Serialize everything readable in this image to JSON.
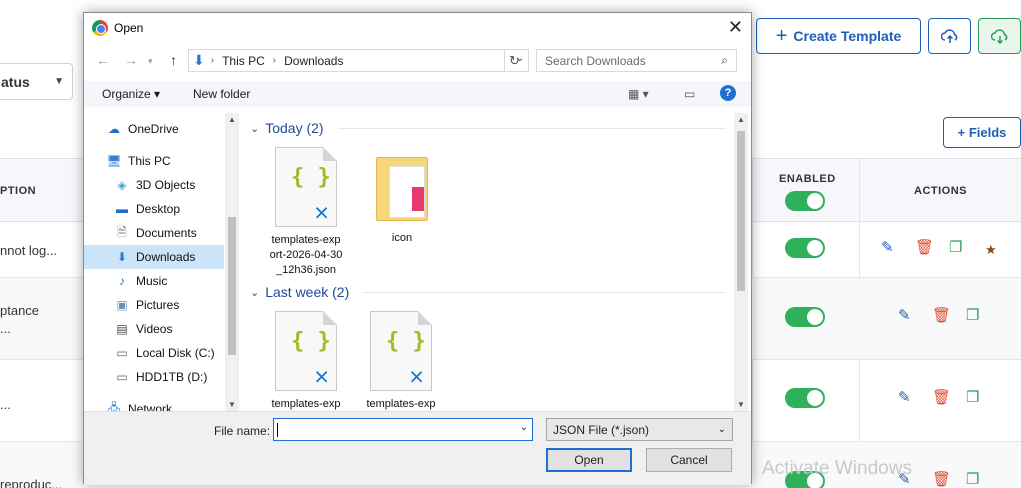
{
  "background": {
    "status_filter": "atus",
    "create_button": "Create Template",
    "fields_button": "+ Fields",
    "table_headers": {
      "description": "PTION",
      "enabled": "ENABLED",
      "actions": "ACTIONS"
    },
    "rows": [
      {
        "desc": "nnot log..."
      },
      {
        "desc": "ptance\n..."
      },
      {
        "desc": "..."
      },
      {
        "desc": "reproduc..."
      }
    ],
    "watermark": "Activate Windows",
    "colors": {
      "accent": "#1e5fb4",
      "toggle_on": "#2fb05b",
      "delete": "#e04a2f"
    }
  },
  "dialog": {
    "title": "Open",
    "path": [
      "This PC",
      "Downloads"
    ],
    "search_placeholder": "Search Downloads",
    "toolbar": {
      "organize": "Organize ▾",
      "new_folder": "New folder"
    },
    "nav_items": [
      {
        "label": "OneDrive",
        "icon": "cloud-icon"
      },
      {
        "label": "This PC",
        "icon": "computer-icon"
      },
      {
        "label": "3D Objects",
        "icon": "cube-icon"
      },
      {
        "label": "Desktop",
        "icon": "desktop-icon"
      },
      {
        "label": "Documents",
        "icon": "document-icon"
      },
      {
        "label": "Downloads",
        "icon": "download-icon",
        "selected": true
      },
      {
        "label": "Music",
        "icon": "music-icon"
      },
      {
        "label": "Pictures",
        "icon": "pictures-icon"
      },
      {
        "label": "Videos",
        "icon": "videos-icon"
      },
      {
        "label": "Local Disk (C:)",
        "icon": "drive-icon"
      },
      {
        "label": "HDD1TB (D:)",
        "icon": "drive-icon"
      },
      {
        "label": "Network",
        "icon": "network-icon"
      }
    ],
    "groups": [
      {
        "label": "Today (2)",
        "files": [
          {
            "name": "templates-export-2026-04-30_12h36.json",
            "display": "templates-exp\nort-2026-04-30\n_12h36.json",
            "type": "json"
          },
          {
            "name": "icon",
            "display": "icon",
            "type": "folder"
          }
        ]
      },
      {
        "label": "Last week (2)",
        "files": [
          {
            "name": "templates-exp",
            "display": "templates-exp",
            "type": "json"
          },
          {
            "name": "templates-exp",
            "display": "templates-exp",
            "type": "json"
          }
        ]
      }
    ],
    "file_name_label": "File name:",
    "file_name_value": "",
    "file_type": "JSON File (*.json)",
    "open_button": "Open",
    "cancel_button": "Cancel"
  }
}
